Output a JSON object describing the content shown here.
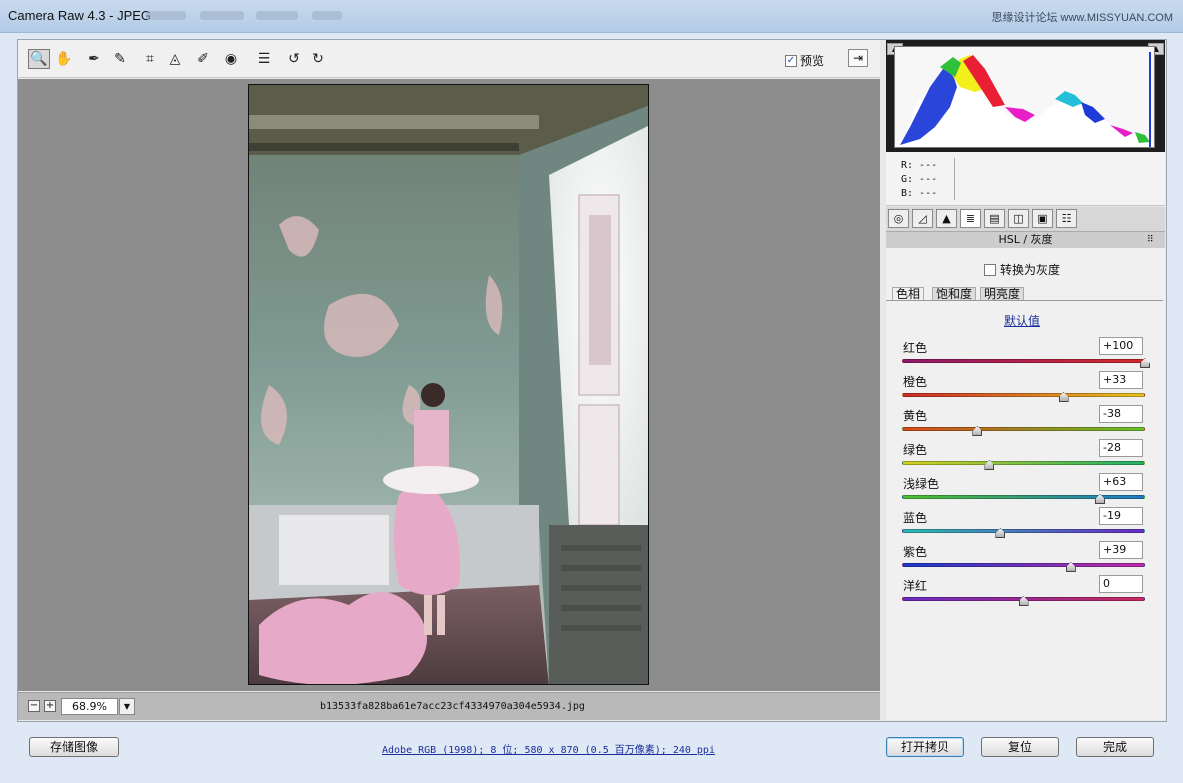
{
  "window": {
    "title": "Camera Raw 4.3 -  JPEG",
    "watermark": "思缘设计论坛 www.MISSYUAN.COM"
  },
  "toolbar": {
    "tools": [
      {
        "name": "zoom-tool-icon",
        "glyph": "🔍"
      },
      {
        "name": "hand-tool-icon",
        "glyph": "✋"
      },
      {
        "name": "white-balance-tool-icon",
        "glyph": "✒"
      },
      {
        "name": "color-sampler-tool-icon",
        "glyph": "✎"
      },
      {
        "name": "crop-tool-icon",
        "glyph": "⌗"
      },
      {
        "name": "straighten-tool-icon",
        "glyph": "◬"
      },
      {
        "name": "spot-removal-tool-icon",
        "glyph": "✐"
      },
      {
        "name": "red-eye-tool-icon",
        "glyph": "◉"
      },
      {
        "name": "preferences-icon",
        "glyph": "☰"
      },
      {
        "name": "rotate-left-icon",
        "glyph": "↺"
      },
      {
        "name": "rotate-right-icon",
        "glyph": "↻"
      }
    ],
    "preview_label": "预览",
    "preview_checked": "✓"
  },
  "status": {
    "zoom_minus": "−",
    "zoom_plus": "+",
    "zoom_value": "68.9%",
    "zoom_drop": "▼",
    "filename": "b13533fa828ba61e7acc23cf4334970a304e5934.jpg"
  },
  "histogram": {
    "readout": {
      "r": "R:  ---",
      "g": "G:  ---",
      "b": "B:  ---"
    }
  },
  "panel": {
    "tab_icons": [
      "aperture-icon",
      "tone-curve-icon",
      "detail-icon",
      "hsl-icon",
      "split-toning-icon",
      "lens-icon",
      "camera-calibration-icon",
      "presets-icon"
    ],
    "title": "HSL / 灰度",
    "menu_glyph": "⠿",
    "grayscale_label": "转换为灰度",
    "subtabs": [
      "色相",
      "饱和度",
      "明亮度"
    ],
    "default_link": "默认值",
    "sliders": [
      {
        "label": "红色",
        "value": "+100",
        "v": 100,
        "from": "#8e1a6b",
        "to": "#d42a2a"
      },
      {
        "label": "橙色",
        "value": "+33",
        "v": 33,
        "from": "#cc2a2a",
        "to": "#e6c51f"
      },
      {
        "label": "黄色",
        "value": "-38",
        "v": -38,
        "from": "#d84a1c",
        "to": "#66c12d"
      },
      {
        "label": "绿色",
        "value": "-28",
        "v": -28,
        "from": "#d5cf22",
        "to": "#20b06a"
      },
      {
        "label": "浅绿色",
        "value": "+63",
        "v": 63,
        "from": "#4cc02d",
        "to": "#2079c9"
      },
      {
        "label": "蓝色",
        "value": "-19",
        "v": -19,
        "from": "#2bbcb0",
        "to": "#6a2bc6"
      },
      {
        "label": "紫色",
        "value": "+39",
        "v": 39,
        "from": "#1a3bc9",
        "to": "#c22aa8"
      },
      {
        "label": "洋红",
        "value": "0",
        "v": 0,
        "from": "#6a2bc6",
        "to": "#c82a5b"
      }
    ]
  },
  "footer": {
    "save_label": "存储图像",
    "workflow_text": "Adobe RGB (1998); 8 位; 580 x 870 (0.5 百万像素); 240 ppi",
    "open_copy_label": "打开拷贝",
    "reset_label": "复位",
    "done_label": "完成"
  }
}
